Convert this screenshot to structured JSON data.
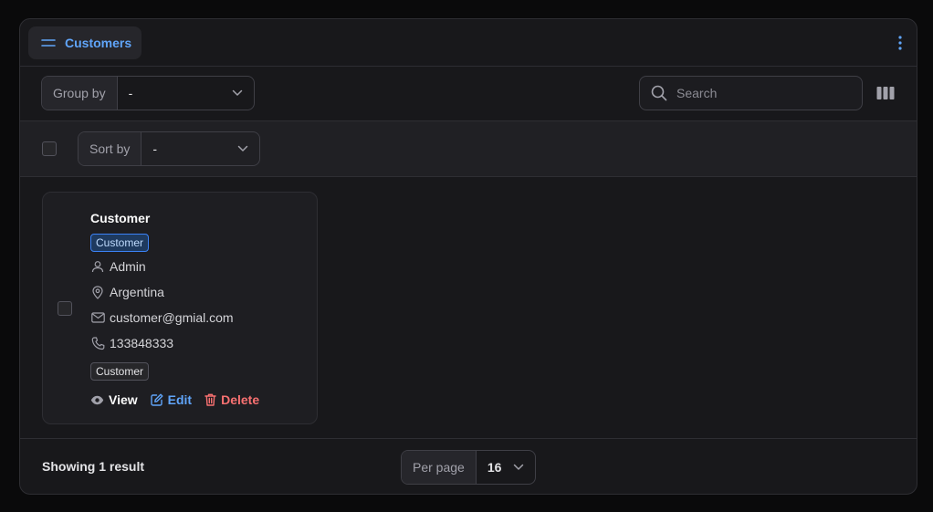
{
  "tab": {
    "label": "Customers"
  },
  "toolbar": {
    "group_by_label": "Group by",
    "group_by_value": "-",
    "search_placeholder": "Search"
  },
  "sortbar": {
    "sort_by_label": "Sort by",
    "sort_by_value": "-"
  },
  "card": {
    "title": "Customer",
    "role_badge": "Customer",
    "user": "Admin",
    "country": "Argentina",
    "email": "customer@gmial.com",
    "phone": "133848333",
    "type_badge": "Customer",
    "actions": {
      "view": "View",
      "edit": "Edit",
      "delete": "Delete"
    }
  },
  "footer": {
    "showing": "Showing 1 result",
    "per_page_label": "Per page",
    "per_page_value": "16"
  },
  "colors": {
    "accent": "#60a5fa",
    "danger": "#f87171",
    "background": "#18181b"
  },
  "icons": [
    "menu-icon",
    "kebab-icon",
    "chevron-down-icon",
    "search-icon",
    "columns-icon",
    "user-icon",
    "map-pin-icon",
    "mail-icon",
    "phone-icon",
    "eye-icon",
    "edit-icon",
    "trash-icon"
  ]
}
